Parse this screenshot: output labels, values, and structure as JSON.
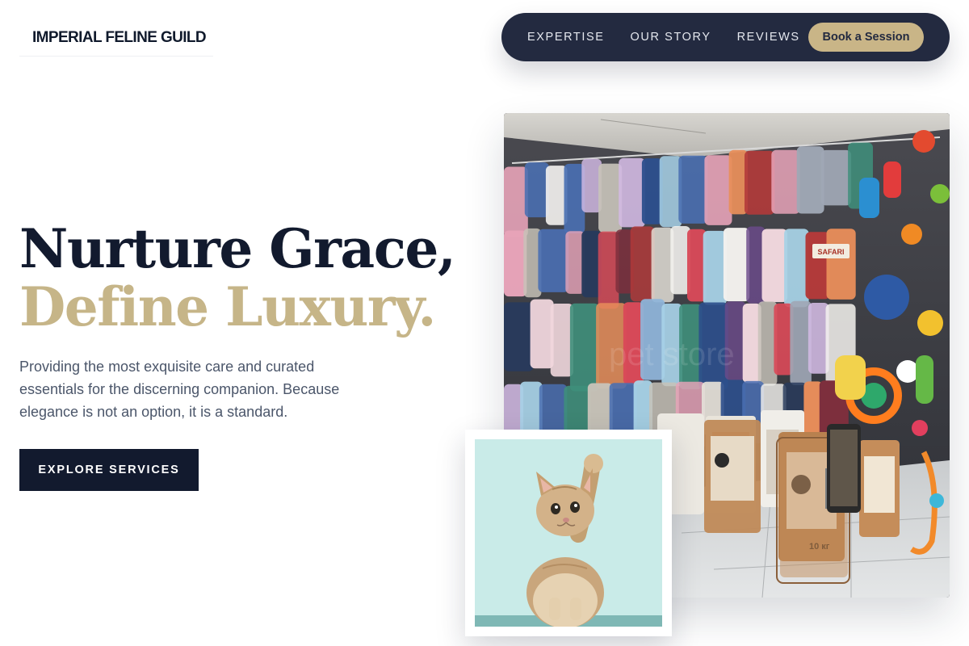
{
  "brand": {
    "name": "IMPERIAL FELINE GUILD"
  },
  "nav": {
    "links": [
      "EXPERTISE",
      "OUR STORY",
      "REVIEWS"
    ],
    "cta": "Book a Session"
  },
  "hero": {
    "headline_line1": "Nurture Grace,",
    "headline_line2": "Define Luxury.",
    "description": "Providing the most exquisite care and curated essentials for the discerning companion. Because elegance is not an option, it is a standard.",
    "cta": "EXPLORE SERVICES"
  },
  "images": {
    "store_photo": {
      "sign_text": "SAFARI",
      "food_bag_text": "10 кг"
    },
    "cat_photo": {}
  },
  "colors": {
    "navy": "#121a2e",
    "nav_bg": "#232a40",
    "gold": "#c9b587",
    "body_text": "#4b566a",
    "cat_bg": "#c9ebe8"
  }
}
